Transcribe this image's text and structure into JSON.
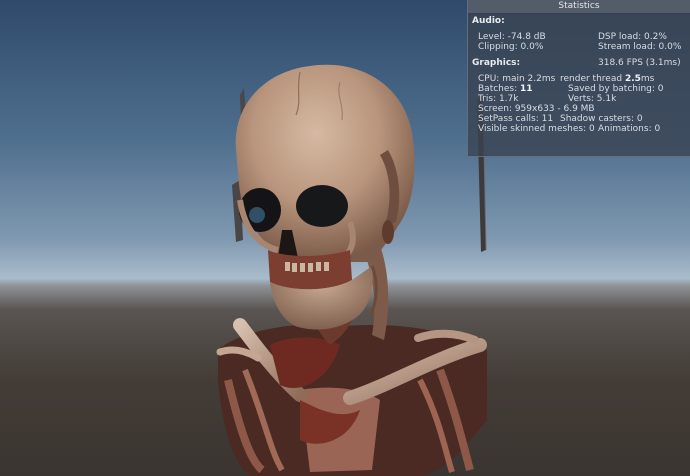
{
  "statistics": {
    "title": "Statistics",
    "audio": {
      "heading": "Audio:",
      "level": "Level: -74.8 dB",
      "dsp_load": "DSP load: 0.2%",
      "clipping": "Clipping: 0.0%",
      "stream_load": "Stream load: 0.0%"
    },
    "graphics": {
      "heading": "Graphics:",
      "fps": "318.6 FPS (3.1ms)",
      "cpu_main": "CPU: main 2.2ms",
      "render_thread_label": "render thread",
      "render_thread_value": "2.5",
      "render_thread_unit": "ms",
      "batches_label": "Batches:",
      "batches_value": "11",
      "saved_by_batching": "Saved by batching: 0",
      "tris": "Tris: 1.7k",
      "verts": "Verts: 5.1k",
      "screen": "Screen: 959x633 - 6.9 MB",
      "setpass": "SetPass calls: 11",
      "shadow_casters": "Shadow casters: 0",
      "visible_skinned": "Visible skinned meshes: 0",
      "animations": "Animations: 0"
    }
  },
  "scene": {
    "subject": "skull-and-ribcage-model",
    "sky_top_color": "#2f4a6b",
    "horizon_color": "#9ab0c2",
    "ground_color": "#3b3531",
    "bone_color": "#b89a85"
  }
}
